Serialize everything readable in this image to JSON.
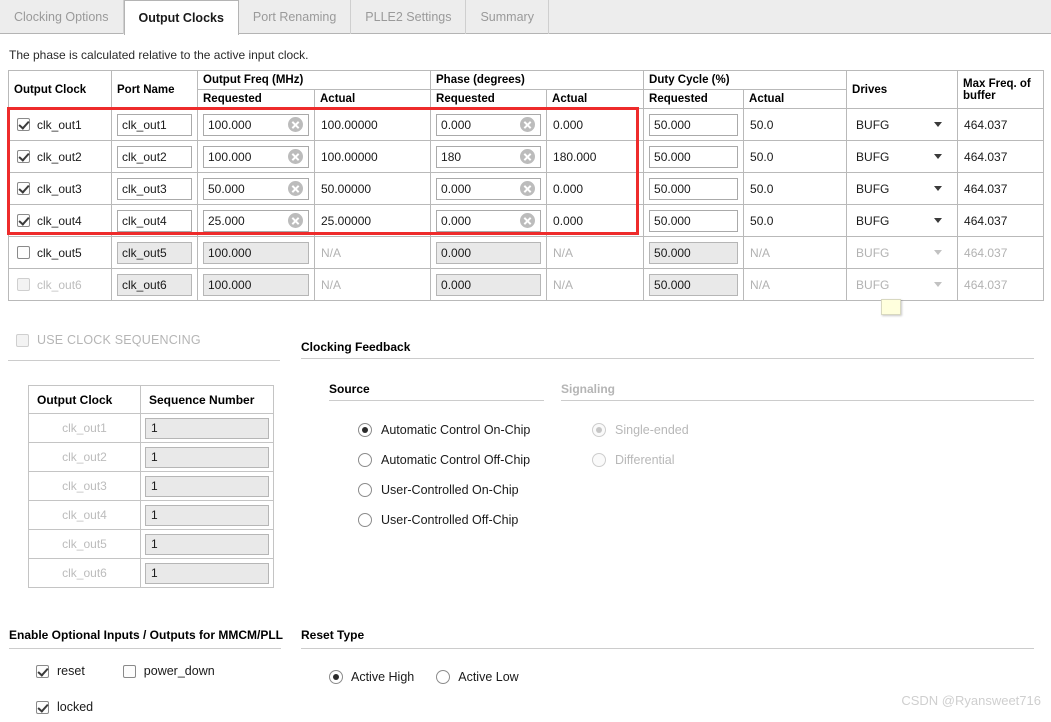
{
  "tabs": [
    {
      "label": "Clocking Options",
      "active": false
    },
    {
      "label": "Output Clocks",
      "active": true
    },
    {
      "label": "Port Renaming",
      "active": false
    },
    {
      "label": "PLLE2 Settings",
      "active": false
    },
    {
      "label": "Summary",
      "active": false
    }
  ],
  "note": "The phase is calculated relative to the active input clock.",
  "clock_table": {
    "group_headers": {
      "output_clock": "Output Clock",
      "port_name": "Port Name",
      "output_freq": "Output Freq (MHz)",
      "phase": "Phase (degrees)",
      "duty_cycle": "Duty Cycle (%)",
      "drives": "Drives",
      "max_freq": "Max Freq. of buffer"
    },
    "sub_headers": {
      "requested": "Requested",
      "actual": "Actual"
    },
    "rows": [
      {
        "name": "clk_out1",
        "checked": true,
        "enabled": true,
        "port_name": "clk_out1",
        "freq_requested": "100.000",
        "freq_actual": "100.00000",
        "phase_requested": "0.000",
        "phase_actual": "0.000",
        "duty_requested": "50.000",
        "duty_actual": "50.0",
        "drives": "BUFG",
        "max_freq": "464.037"
      },
      {
        "name": "clk_out2",
        "checked": true,
        "enabled": true,
        "port_name": "clk_out2",
        "freq_requested": "100.000",
        "freq_actual": "100.00000",
        "phase_requested": "180",
        "phase_actual": "180.000",
        "duty_requested": "50.000",
        "duty_actual": "50.0",
        "drives": "BUFG",
        "max_freq": "464.037"
      },
      {
        "name": "clk_out3",
        "checked": true,
        "enabled": true,
        "port_name": "clk_out3",
        "freq_requested": "50.000",
        "freq_actual": "50.00000",
        "phase_requested": "0.000",
        "phase_actual": "0.000",
        "duty_requested": "50.000",
        "duty_actual": "50.0",
        "drives": "BUFG",
        "max_freq": "464.037"
      },
      {
        "name": "clk_out4",
        "checked": true,
        "enabled": true,
        "port_name": "clk_out4",
        "freq_requested": "25.000",
        "freq_actual": "25.00000",
        "phase_requested": "0.000",
        "phase_actual": "0.000",
        "duty_requested": "50.000",
        "duty_actual": "50.0",
        "drives": "BUFG",
        "max_freq": "464.037"
      },
      {
        "name": "clk_out5",
        "checked": false,
        "enabled": false,
        "port_name": "clk_out5",
        "freq_requested": "100.000",
        "freq_actual": "N/A",
        "phase_requested": "0.000",
        "phase_actual": "N/A",
        "duty_requested": "50.000",
        "duty_actual": "N/A",
        "drives": "BUFG",
        "max_freq": "464.037"
      },
      {
        "name": "clk_out6",
        "checked": false,
        "enabled": false,
        "port_name": "clk_out6",
        "freq_requested": "100.000",
        "freq_actual": "N/A",
        "phase_requested": "0.000",
        "phase_actual": "N/A",
        "duty_requested": "50.000",
        "duty_actual": "N/A",
        "drives": "BUFG",
        "max_freq": "464.037"
      }
    ]
  },
  "sequencing": {
    "use_label": "USE CLOCK SEQUENCING",
    "use_checked": false,
    "headers": {
      "clock": "Output Clock",
      "number": "Sequence Number"
    },
    "rows": [
      {
        "clock": "clk_out1",
        "number": "1"
      },
      {
        "clock": "clk_out2",
        "number": "1"
      },
      {
        "clock": "clk_out3",
        "number": "1"
      },
      {
        "clock": "clk_out4",
        "number": "1"
      },
      {
        "clock": "clk_out5",
        "number": "1"
      },
      {
        "clock": "clk_out6",
        "number": "1"
      }
    ]
  },
  "feedback": {
    "title": "Clocking Feedback",
    "source_title": "Source",
    "signaling_title": "Signaling",
    "source_options": [
      {
        "label": "Automatic Control On-Chip",
        "selected": true
      },
      {
        "label": "Automatic Control Off-Chip",
        "selected": false
      },
      {
        "label": "User-Controlled On-Chip",
        "selected": false
      },
      {
        "label": "User-Controlled Off-Chip",
        "selected": false
      }
    ],
    "signaling_options": [
      {
        "label": "Single-ended",
        "selected": true
      },
      {
        "label": "Differential",
        "selected": false
      }
    ]
  },
  "optional_io": {
    "title": "Enable Optional Inputs / Outputs for MMCM/PLL",
    "items": [
      {
        "label": "reset",
        "checked": true
      },
      {
        "label": "power_down",
        "checked": false
      },
      {
        "label": "locked",
        "checked": true
      }
    ]
  },
  "reset_type": {
    "title": "Reset Type",
    "options": [
      {
        "label": "Active High",
        "selected": true
      },
      {
        "label": "Active Low",
        "selected": false
      }
    ]
  },
  "watermark": "CSDN @Ryansweet716",
  "colors": {
    "highlight": "#ee2b2b",
    "tab_active_text": "#1a1a1a",
    "disabled_text": "#b2b2b2"
  }
}
